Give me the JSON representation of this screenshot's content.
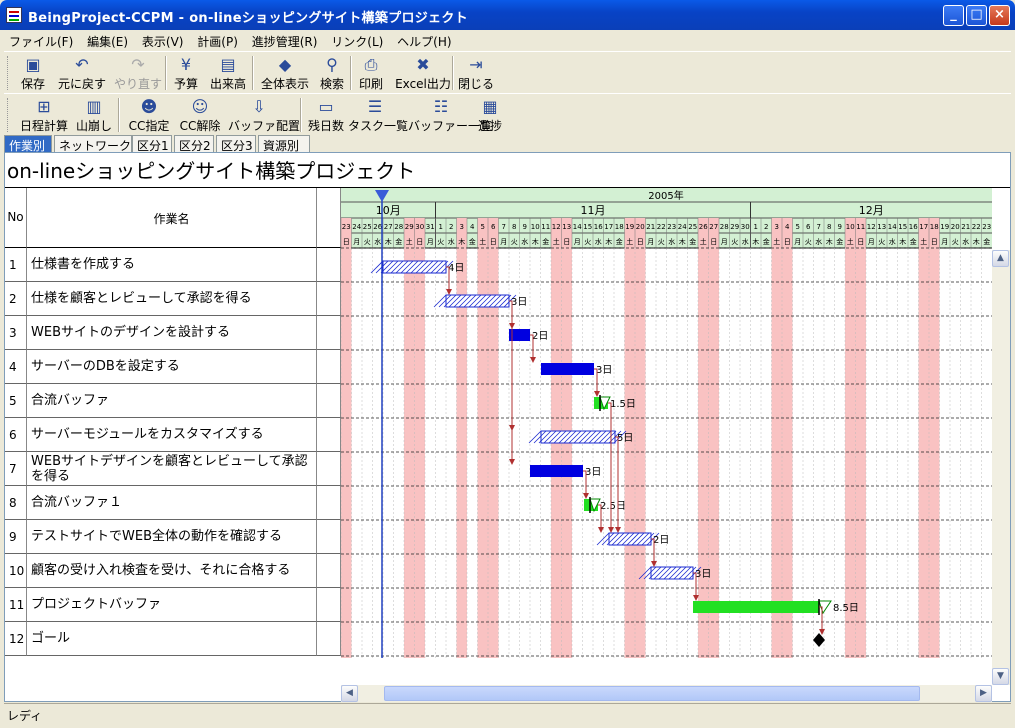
{
  "window": {
    "title": "BeingProject-CCPM - on-lineショッピングサイト構築プロジェクト",
    "minimize": "_",
    "maximize": "□",
    "close": "×"
  },
  "menu": [
    "ファイル(F)",
    "編集(E)",
    "表示(V)",
    "計画(P)",
    "進捗管理(R)",
    "リンク(L)",
    "ヘルプ(H)"
  ],
  "toolbar1": [
    {
      "label": "保存",
      "icon": "save-icon",
      "glyph": "▣",
      "enabled": true
    },
    {
      "label": "元に戻す",
      "icon": "undo-icon",
      "glyph": "↶",
      "enabled": true
    },
    {
      "label": "やり直す",
      "icon": "redo-icon",
      "glyph": "↷",
      "enabled": false
    },
    {
      "label": "予算",
      "icon": "budget-icon",
      "glyph": "¥",
      "enabled": true
    },
    {
      "label": "出来高",
      "icon": "earned-value-icon",
      "glyph": "▤",
      "enabled": true
    },
    {
      "label": "全体表示",
      "icon": "fit-all-icon",
      "glyph": "◆",
      "enabled": true
    },
    {
      "label": "検索",
      "icon": "binoculars-icon",
      "glyph": "⚲",
      "enabled": true
    },
    {
      "label": "印刷",
      "icon": "print-icon",
      "glyph": "⎙",
      "enabled": true
    },
    {
      "label": "Excel出力",
      "icon": "excel-export-icon",
      "glyph": "✖",
      "enabled": true
    },
    {
      "label": "閉じる",
      "icon": "close-door-icon",
      "glyph": "⇥",
      "enabled": true
    }
  ],
  "toolbar2": [
    {
      "label": "日程計算",
      "icon": "schedule-calc-icon",
      "glyph": "⊞"
    },
    {
      "label": "山崩し",
      "icon": "leveling-icon",
      "glyph": "▥"
    },
    {
      "label": "CC指定",
      "icon": "cc-set-icon",
      "glyph": "☻"
    },
    {
      "label": "CC解除",
      "icon": "cc-clear-icon",
      "glyph": "☺"
    },
    {
      "label": "バッファ配置",
      "icon": "buffer-place-icon",
      "glyph": "⇩"
    },
    {
      "label": "残日数",
      "icon": "remaining-days-icon",
      "glyph": "▭"
    },
    {
      "label": "タスク一覧",
      "icon": "task-list-icon",
      "glyph": "☰"
    },
    {
      "label": "バッファー一覧",
      "icon": "buffer-list-icon",
      "glyph": "☷"
    },
    {
      "label": "進捗",
      "icon": "progress-icon",
      "glyph": "▦"
    }
  ],
  "tabs": [
    "作業別",
    "ネットワーク図",
    "区分1",
    "区分2",
    "区分3",
    "資源別"
  ],
  "active_tab": 0,
  "project_title": "on-lineショッピングサイト構築プロジェクト",
  "columns": {
    "no": "No",
    "name": "作業名"
  },
  "timeline": {
    "year": "2005年",
    "months": [
      "10月",
      "11月",
      "12月"
    ],
    "days": [
      "23",
      "24",
      "25",
      "26",
      "27",
      "28",
      "29",
      "30",
      "31",
      "1",
      "2",
      "3",
      "4",
      "5",
      "6",
      "7",
      "8",
      "9",
      "10",
      "11",
      "12",
      "13",
      "14",
      "15",
      "16",
      "17",
      "18",
      "19",
      "20",
      "21",
      "22",
      "23",
      "24",
      "25",
      "26",
      "27",
      "28",
      "29",
      "30",
      "1",
      "2",
      "3",
      "4",
      "5",
      "6",
      "7",
      "8",
      "9",
      "10",
      "11",
      "12",
      "13",
      "14",
      "15",
      "16",
      "17",
      "18",
      "19",
      "20",
      "21",
      "22",
      "23"
    ],
    "weekdays": [
      "日",
      "月",
      "火",
      "水",
      "木",
      "金",
      "土",
      "日",
      "月",
      "火",
      "水",
      "木",
      "金",
      "土",
      "日",
      "月",
      "火",
      "水",
      "木",
      "金",
      "土",
      "日",
      "月",
      "火",
      "水",
      "木",
      "金",
      "土",
      "日",
      "月",
      "火",
      "水",
      "木",
      "金",
      "土",
      "日",
      "月",
      "火",
      "水",
      "木",
      "金",
      "土",
      "日",
      "月",
      "火",
      "水",
      "木",
      "金",
      "土",
      "日",
      "月",
      "火",
      "水",
      "木",
      "金",
      "土",
      "日",
      "月",
      "火",
      "水",
      "木",
      "金"
    ]
  },
  "tasks": [
    {
      "no": "1",
      "name": "仕様書を作成する",
      "start": 4,
      "days": 4,
      "label": "4日",
      "kind": "task-planned"
    },
    {
      "no": "2",
      "name": "仕様を顧客とレビューして承認を得る",
      "start": 10,
      "days": 3,
      "label": "3日",
      "kind": "task-planned"
    },
    {
      "no": "3",
      "name": "WEBサイトのデザインを設計する",
      "start": 16,
      "days": 2,
      "label": "2日",
      "kind": "task-critical"
    },
    {
      "no": "4",
      "name": "サーバーのDBを設定する",
      "start": 19,
      "days": 3,
      "label": "3日",
      "kind": "task-critical"
    },
    {
      "no": "5",
      "name": "合流バッファ",
      "start": 24,
      "days": 1.5,
      "label": "1.5日",
      "kind": "buffer"
    },
    {
      "no": "6",
      "name": "サーバーモジュールをカスタマイズする",
      "start": 18,
      "days": 5,
      "label": "5日",
      "kind": "task-planned"
    },
    {
      "no": "7",
      "name": "WEBサイトデザインを顧客とレビューして承認を得る",
      "start": 18,
      "days": 3,
      "label": "3日",
      "kind": "task-critical"
    },
    {
      "no": "8",
      "name": "合流バッファ１",
      "start": 23,
      "days": 2.5,
      "label": "2.5日",
      "kind": "buffer"
    },
    {
      "no": "9",
      "name": "テストサイトでWEB全体の動作を確認する",
      "start": 25,
      "days": 2,
      "label": "2日",
      "kind": "task-planned"
    },
    {
      "no": "10",
      "name": "顧客の受け入れ検査を受け、それに合格する",
      "start": 29,
      "days": 2,
      "label": "3日",
      "kind": "task-planned"
    },
    {
      "no": "11",
      "name": "プロジェクトバッファ",
      "start": 33,
      "days": 8.5,
      "label": "8.5日",
      "kind": "buffer-long"
    },
    {
      "no": "12",
      "name": "ゴール",
      "start": 45.5,
      "days": 0,
      "label": "",
      "kind": "milestone"
    }
  ],
  "holiday_columns": [
    0,
    6,
    7,
    11,
    13,
    14,
    20,
    21,
    27,
    28,
    34,
    35,
    41,
    42,
    48,
    49,
    55,
    56
  ],
  "status": "レディ",
  "colors": {
    "weekend": "#F9C2C2",
    "critical": "#0000E0",
    "buffer": "#22E022",
    "link": "#B03030",
    "header": "#D3F0D3",
    "today": "#2040C0"
  }
}
